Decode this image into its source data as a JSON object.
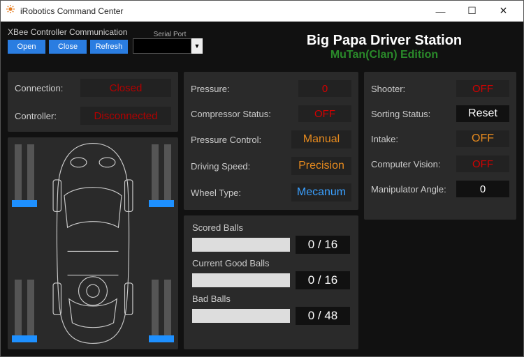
{
  "window": {
    "title": "iRobotics Command Center"
  },
  "xbee": {
    "label": "XBee Controller Communication",
    "open": "Open",
    "close": "Close",
    "refresh": "Refresh",
    "serial_label": "Serial Port"
  },
  "header": {
    "line1": "Big Papa Driver Station",
    "line2": "MuTan(Clan) Edition"
  },
  "status": {
    "connection_label": "Connection:",
    "connection_value": "Closed",
    "controller_label": "Controller:",
    "controller_value": "Disconnected"
  },
  "mid": {
    "pressure_label": "Pressure:",
    "pressure_value": "0",
    "compressor_label": "Compressor Status:",
    "compressor_value": "OFF",
    "pcontrol_label": "Pressure Control:",
    "pcontrol_value": "Manual",
    "speed_label": "Driving Speed:",
    "speed_value": "Precision",
    "wheel_label": "Wheel Type:",
    "wheel_value": "Mecanum"
  },
  "right": {
    "shooter_label": "Shooter:",
    "shooter_value": "OFF",
    "sort_label": "Sorting Status:",
    "sort_value": "Reset",
    "intake_label": "Intake:",
    "intake_value": "OFF",
    "cv_label": "Computer Vision:",
    "cv_value": "OFF",
    "manip_label": "Manipulator Angle:",
    "manip_value": "0"
  },
  "balls": {
    "scored_label": "Scored Balls",
    "scored_value": "0 / 16",
    "good_label": "Current Good Balls",
    "good_value": "0 / 16",
    "bad_label": "Bad Balls",
    "bad_value": "0 / 48"
  }
}
